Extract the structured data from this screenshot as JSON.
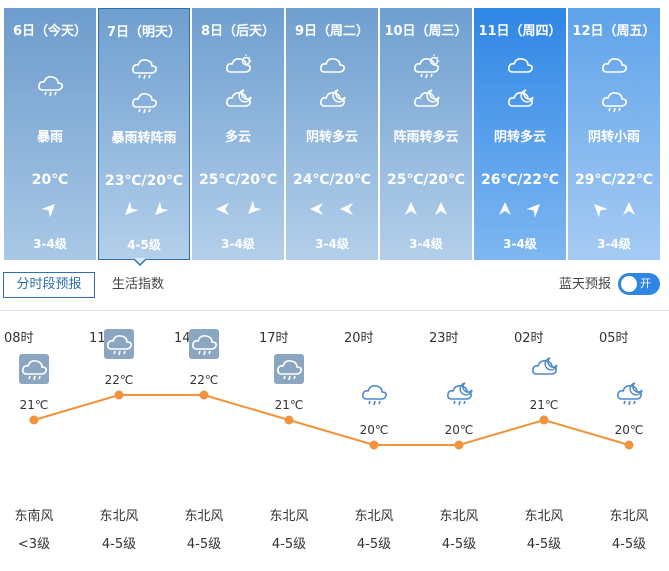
{
  "days": [
    {
      "date": "6日（今天）",
      "desc": "暴雨",
      "temp": "20℃",
      "level": "3-4级",
      "style": "past",
      "icons": [
        "rain-heavy-icon"
      ],
      "winds": [
        "wind-ne-arrow-icon"
      ]
    },
    {
      "date": "7日（明天）",
      "desc": "暴雨转阵雨",
      "temp": "23℃/20℃",
      "level": "4-5级",
      "style": "sel",
      "icons": [
        "rain-heavy-icon",
        "shower-icon"
      ],
      "winds": [
        "wind-sw-arrow-icon",
        "wind-sw-arrow-icon"
      ]
    },
    {
      "date": "8日（后天）",
      "desc": "多云",
      "temp": "25℃/20℃",
      "level": "3-4级",
      "style": "normal",
      "icons": [
        "partly-cloudy-sun-icon",
        "partly-cloudy-moon-icon"
      ],
      "winds": [
        "wind-w-arrow-icon",
        "wind-sw-arrow-icon"
      ]
    },
    {
      "date": "9日（周二）",
      "desc": "阴转多云",
      "temp": "24℃/20℃",
      "level": "3-4级",
      "style": "normal",
      "icons": [
        "cloudy-icon",
        "partly-cloudy-moon-icon"
      ],
      "winds": [
        "wind-w-arrow-icon",
        "wind-w-arrow-icon"
      ]
    },
    {
      "date": "10日（周三）",
      "desc": "阵雨转多云",
      "temp": "25℃/20℃",
      "level": "3-4级",
      "style": "normal",
      "icons": [
        "shower-sun-icon",
        "partly-cloudy-moon-icon"
      ],
      "winds": [
        "wind-n-arrow-icon",
        "wind-n-arrow-icon"
      ]
    },
    {
      "date": "11日（周四）",
      "desc": "阴转多云",
      "temp": "26℃/22℃",
      "level": "3-4级",
      "style": "blue1",
      "icons": [
        "cloudy-icon",
        "partly-cloudy-moon-icon"
      ],
      "winds": [
        "wind-n-arrow-icon",
        "wind-ne-arrow-icon"
      ]
    },
    {
      "date": "12日（周五）",
      "desc": "阴转小雨",
      "temp": "29℃/22℃",
      "level": "3-4级",
      "style": "blue2",
      "icons": [
        "cloudy-icon",
        "rain-light-icon"
      ],
      "winds": [
        "wind-nw-arrow-icon",
        "wind-n-arrow-icon"
      ]
    }
  ],
  "tabs": {
    "active": "分时段预报",
    "other": "生活指数"
  },
  "blue_sky": {
    "label": "蓝天预报",
    "toggle": "开"
  },
  "hourly": [
    {
      "hour": "08时",
      "temp": "21℃",
      "temp_value": 21,
      "wind": "东南风",
      "level": "<3级",
      "icon": "rain-heavy-icon",
      "boxed": true
    },
    {
      "hour": "11时",
      "temp": "22℃",
      "temp_value": 22,
      "wind": "东北风",
      "level": "4-5级",
      "icon": "rain-heavy-icon",
      "boxed": true
    },
    {
      "hour": "14时",
      "temp": "22℃",
      "temp_value": 22,
      "wind": "东北风",
      "level": "4-5级",
      "icon": "rain-heavy-icon",
      "boxed": true
    },
    {
      "hour": "17时",
      "temp": "21℃",
      "temp_value": 21,
      "wind": "东北风",
      "level": "4-5级",
      "icon": "shower-icon",
      "boxed": true
    },
    {
      "hour": "20时",
      "temp": "20℃",
      "temp_value": 20,
      "wind": "东北风",
      "level": "4-5级",
      "icon": "shower-icon",
      "boxed": false
    },
    {
      "hour": "23时",
      "temp": "20℃",
      "temp_value": 20,
      "wind": "东北风",
      "level": "4-5级",
      "icon": "shower-moon-icon",
      "boxed": false
    },
    {
      "hour": "02时",
      "temp": "21℃",
      "temp_value": 21,
      "wind": "东北风",
      "level": "4-5级",
      "icon": "partly-cloudy-moon-icon",
      "boxed": false
    },
    {
      "hour": "05时",
      "temp": "20℃",
      "temp_value": 20,
      "wind": "东北风",
      "level": "4-5级",
      "icon": "shower-moon-icon",
      "boxed": false
    }
  ],
  "colors": {
    "line": "#f0933a",
    "point": "#f0933a",
    "blue_day": "#2f86e6",
    "selected_border": "#2f6fb3"
  }
}
